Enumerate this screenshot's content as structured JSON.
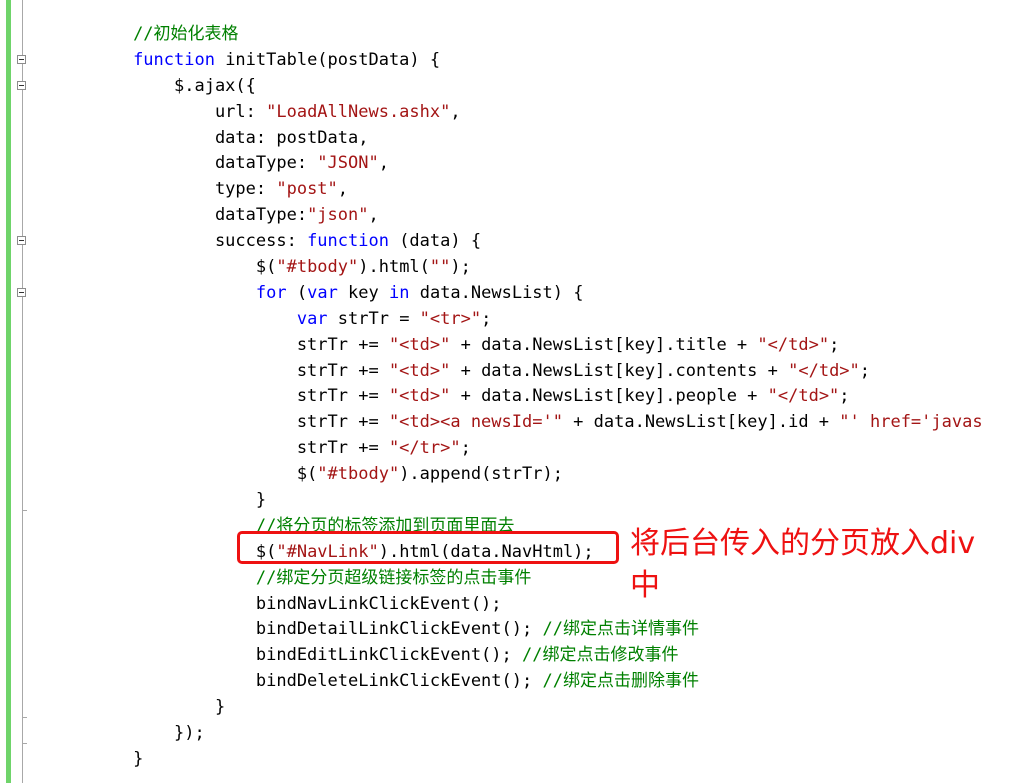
{
  "editor": {
    "language": "javascript",
    "colors": {
      "keyword": "#0000ff",
      "string": "#a31515",
      "comment": "#008000",
      "plain": "#000000",
      "change_bar": "#6fd46a",
      "annotation": "#ee1111"
    },
    "lines": [
      [
        [
          "cmt",
          "//初始化表格"
        ]
      ],
      [
        [
          "kw",
          "function"
        ],
        [
          "p",
          " initTable(postData) {"
        ]
      ],
      [
        [
          "p",
          "    $.ajax({"
        ]
      ],
      [
        [
          "p",
          "        url: "
        ],
        [
          "str",
          "\"LoadAllNews.ashx\""
        ],
        [
          "p",
          ","
        ]
      ],
      [
        [
          "p",
          "        data: postData,"
        ]
      ],
      [
        [
          "p",
          "        dataType: "
        ],
        [
          "str",
          "\"JSON\""
        ],
        [
          "p",
          ","
        ]
      ],
      [
        [
          "p",
          "        type: "
        ],
        [
          "str",
          "\"post\""
        ],
        [
          "p",
          ","
        ]
      ],
      [
        [
          "p",
          "        dataType:"
        ],
        [
          "str",
          "\"json\""
        ],
        [
          "p",
          ","
        ]
      ],
      [
        [
          "p",
          "        success: "
        ],
        [
          "kw",
          "function"
        ],
        [
          "p",
          " (data) {"
        ]
      ],
      [
        [
          "p",
          "            $("
        ],
        [
          "str",
          "\"#tbody\""
        ],
        [
          "p",
          ").html("
        ],
        [
          "str",
          "\"\""
        ],
        [
          "p",
          ");"
        ]
      ],
      [
        [
          "p",
          "            "
        ],
        [
          "kw",
          "for"
        ],
        [
          "p",
          " ("
        ],
        [
          "kw",
          "var"
        ],
        [
          "p",
          " key "
        ],
        [
          "kw",
          "in"
        ],
        [
          "p",
          " data.NewsList) {"
        ]
      ],
      [
        [
          "p",
          "                "
        ],
        [
          "kw",
          "var"
        ],
        [
          "p",
          " strTr = "
        ],
        [
          "str",
          "\"<tr>\""
        ],
        [
          "p",
          ";"
        ]
      ],
      [
        [
          "p",
          "                strTr += "
        ],
        [
          "str",
          "\"<td>\""
        ],
        [
          "p",
          " + data.NewsList[key].title + "
        ],
        [
          "str",
          "\"</td>\""
        ],
        [
          "p",
          ";"
        ]
      ],
      [
        [
          "p",
          "                strTr += "
        ],
        [
          "str",
          "\"<td>\""
        ],
        [
          "p",
          " + data.NewsList[key].contents + "
        ],
        [
          "str",
          "\"</td>\""
        ],
        [
          "p",
          ";"
        ]
      ],
      [
        [
          "p",
          "                strTr += "
        ],
        [
          "str",
          "\"<td>\""
        ],
        [
          "p",
          " + data.NewsList[key].people + "
        ],
        [
          "str",
          "\"</td>\""
        ],
        [
          "p",
          ";"
        ]
      ],
      [
        [
          "p",
          "                strTr += "
        ],
        [
          "str",
          "\"<td><a newsId='\""
        ],
        [
          "p",
          " + data.NewsList[key].id + "
        ],
        [
          "str",
          "\"' href='javas"
        ]
      ],
      [
        [
          "p",
          "                strTr += "
        ],
        [
          "str",
          "\"</tr>\""
        ],
        [
          "p",
          ";"
        ]
      ],
      [
        [
          "p",
          "                $("
        ],
        [
          "str",
          "\"#tbody\""
        ],
        [
          "p",
          ").append(strTr);"
        ]
      ],
      [
        [
          "p",
          "            }"
        ]
      ],
      [
        [
          "p",
          "            "
        ],
        [
          "cmt",
          "//将分页的标签添加到页面里面去"
        ]
      ],
      [
        [
          "p",
          "            $("
        ],
        [
          "str",
          "\"#NavLink\""
        ],
        [
          "p",
          ").html(data.NavHtml);"
        ]
      ],
      [
        [
          "p",
          "            "
        ],
        [
          "cmt",
          "//绑定分页超级链接标签的点击事件"
        ]
      ],
      [
        [
          "p",
          "            bindNavLinkClickEvent();"
        ]
      ],
      [
        [
          "p",
          "            bindDetailLinkClickEvent(); "
        ],
        [
          "cmt",
          "//绑定点击详情事件"
        ]
      ],
      [
        [
          "p",
          "            bindEditLinkClickEvent(); "
        ],
        [
          "cmt",
          "//绑定点击修改事件"
        ]
      ],
      [
        [
          "p",
          "            bindDeleteLinkClickEvent(); "
        ],
        [
          "cmt",
          "//绑定点击删除事件"
        ]
      ],
      [
        [
          "p",
          "        }"
        ]
      ],
      [
        [
          "p",
          "    });"
        ]
      ],
      [
        [
          "p",
          "}"
        ]
      ]
    ]
  },
  "annotation": {
    "text": "将后台传入的分页放入div中"
  }
}
